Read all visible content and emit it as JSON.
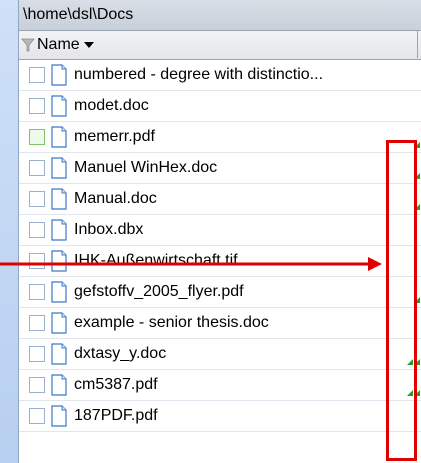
{
  "path": "\\home\\dsl\\Docs",
  "header": {
    "name_label": "Name"
  },
  "files": [
    {
      "name": "numbered - degree with distinctio...",
      "checkbox_highlighted": false,
      "marks": 0
    },
    {
      "name": "modet.doc",
      "checkbox_highlighted": false,
      "marks": 0
    },
    {
      "name": "memerr.pdf",
      "checkbox_highlighted": true,
      "marks": 1
    },
    {
      "name": "Manuel WinHex.doc",
      "checkbox_highlighted": false,
      "marks": 1
    },
    {
      "name": "Manual.doc",
      "checkbox_highlighted": false,
      "marks": 1
    },
    {
      "name": "Inbox.dbx",
      "checkbox_highlighted": false,
      "marks": 0
    },
    {
      "name": "IHK-Außenwirtschaft.tif",
      "checkbox_highlighted": false,
      "marks": 0
    },
    {
      "name": "gefstoffv_2005_flyer.pdf",
      "checkbox_highlighted": false,
      "marks": 1
    },
    {
      "name": "example - senior thesis.doc",
      "checkbox_highlighted": false,
      "marks": 0
    },
    {
      "name": "dxtasy_y.doc",
      "checkbox_highlighted": false,
      "marks": 2
    },
    {
      "name": "cm5387.pdf",
      "checkbox_highlighted": false,
      "marks": 2
    },
    {
      "name": "187PDF.pdf",
      "checkbox_highlighted": false,
      "marks": 0
    }
  ],
  "colors": {
    "annotation": "#e00000",
    "mark": "#22a022"
  }
}
